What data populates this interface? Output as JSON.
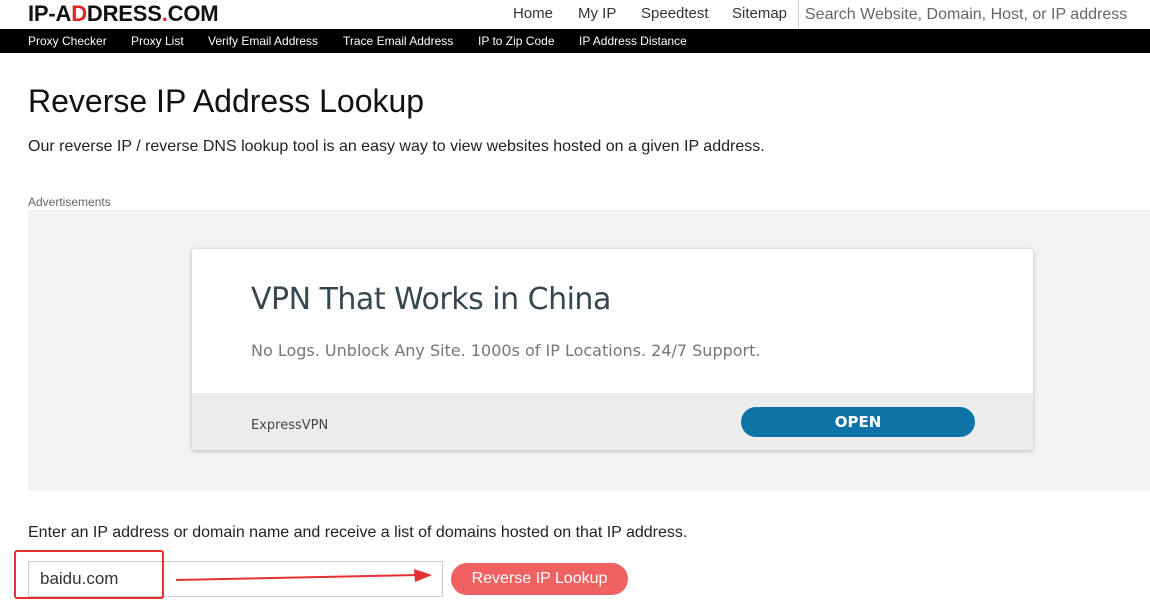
{
  "header": {
    "logo": {
      "part1": "IP-A",
      "strike_letter": "D",
      "part2": "DRESS",
      "dot": ".",
      "part3": "COM"
    },
    "nav": [
      "Home",
      "My IP",
      "Speedtest",
      "Sitemap"
    ],
    "search_placeholder": "Search Website, Domain, Host, or IP address"
  },
  "subnav": [
    "Proxy Checker",
    "Proxy List",
    "Verify Email Address",
    "Trace Email Address",
    "IP to Zip Code",
    "IP Address Distance"
  ],
  "page": {
    "title": "Reverse IP Address Lookup",
    "intro": "Our reverse IP / reverse DNS lookup tool is an easy way to view websites hosted on a given IP address.",
    "ads_label": "Advertisements"
  },
  "ad": {
    "headline": "VPN That Works in China",
    "description": "No Logs. Unblock Any Site. 1000s of IP Locations. 24/7 Support.",
    "brand": "ExpressVPN",
    "cta": "OPEN"
  },
  "lookup": {
    "instruction": "Enter an IP address or domain name and receive a list of domains hosted on that IP address.",
    "input_value": "baidu.com",
    "button_label": "Reverse IP Lookup"
  },
  "colors": {
    "accent": "#e0262a",
    "button": "#f06262",
    "ad_cta": "#0e73a6",
    "annotation": "#e53030"
  }
}
